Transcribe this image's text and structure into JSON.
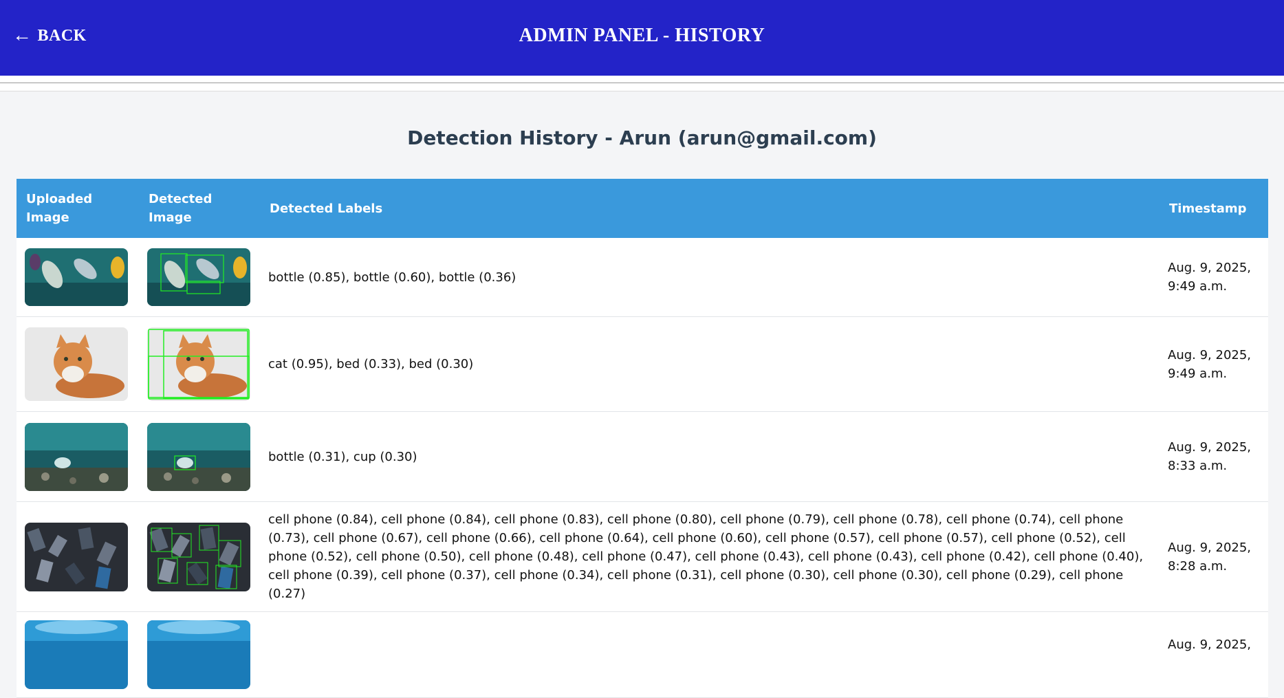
{
  "header": {
    "back_label": "BACK",
    "title": "ADMIN PANEL - HISTORY"
  },
  "page": {
    "heading": "Detection History - Arun (arun@gmail.com)"
  },
  "table": {
    "columns": [
      "Uploaded Image",
      "Detected Image",
      "Detected Labels",
      "Timestamp"
    ],
    "rows": [
      {
        "uploaded_icon": "ocean-bottles-image",
        "detected_icon": "ocean-bottles-detected-image",
        "labels": "bottle (0.85), bottle (0.60), bottle (0.36)",
        "timestamp": "Aug. 9, 2025, 9:49 a.m."
      },
      {
        "uploaded_icon": "cat-image",
        "detected_icon": "cat-detected-image",
        "labels": "cat (0.95), bed (0.33), bed (0.30)",
        "timestamp": "Aug. 9, 2025, 9:49 a.m."
      },
      {
        "uploaded_icon": "seabed-plastic-image",
        "detected_icon": "seabed-plastic-detected-image",
        "labels": "bottle (0.31), cup (0.30)",
        "timestamp": "Aug. 9, 2025, 8:33 a.m."
      },
      {
        "uploaded_icon": "phones-pile-image",
        "detected_icon": "phones-pile-detected-image",
        "labels": "cell phone (0.84), cell phone (0.84), cell phone (0.83), cell phone (0.80), cell phone (0.79), cell phone (0.78), cell phone (0.74), cell phone (0.73), cell phone (0.67), cell phone (0.66), cell phone (0.64), cell phone (0.60), cell phone (0.57), cell phone (0.57), cell phone (0.52), cell phone (0.52), cell phone (0.50), cell phone (0.48), cell phone (0.47), cell phone (0.43), cell phone (0.43), cell phone (0.42), cell phone (0.40), cell phone (0.39), cell phone (0.37), cell phone (0.34), cell phone (0.31), cell phone (0.30), cell phone (0.30), cell phone (0.29), cell phone (0.27)",
        "timestamp": "Aug. 9, 2025, 8:28 a.m."
      },
      {
        "uploaded_icon": "underwater-image",
        "detected_icon": "underwater-detected-image",
        "labels": "",
        "timestamp": "Aug. 9, 2025,"
      }
    ]
  },
  "colors": {
    "topbar": "#2323c8",
    "table_header": "#3a99dc",
    "heading_text": "#2c3e50",
    "detection_box": "#22ee22"
  }
}
